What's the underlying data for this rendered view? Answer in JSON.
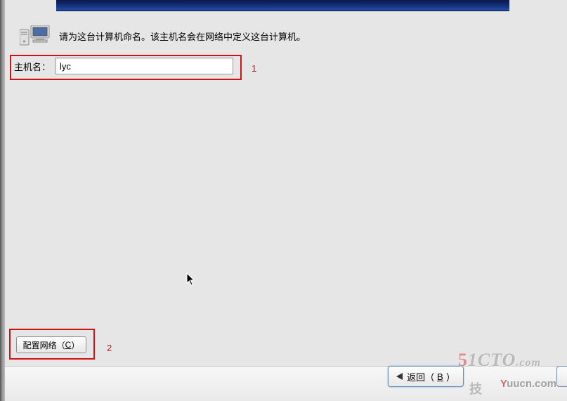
{
  "instruction": "请为这台计算机命名。该主机名会在网络中定义这台计算机。",
  "hostname": {
    "label": "主机名：",
    "value": "lyc"
  },
  "annotations": {
    "one": "1",
    "two": "2"
  },
  "buttons": {
    "configure_network_prefix": "配置网络（",
    "configure_network_mnemonic": "C",
    "configure_network_suffix": "）",
    "back_prefix": "返回（",
    "back_mnemonic": "B",
    "back_suffix": "）"
  },
  "watermarks": {
    "cto_5": "5",
    "cto_rest": "1CTO",
    "cto_com": ".com",
    "frag": "技",
    "yuucn_y": "Y",
    "yuucn_rest": "uucn.com"
  }
}
